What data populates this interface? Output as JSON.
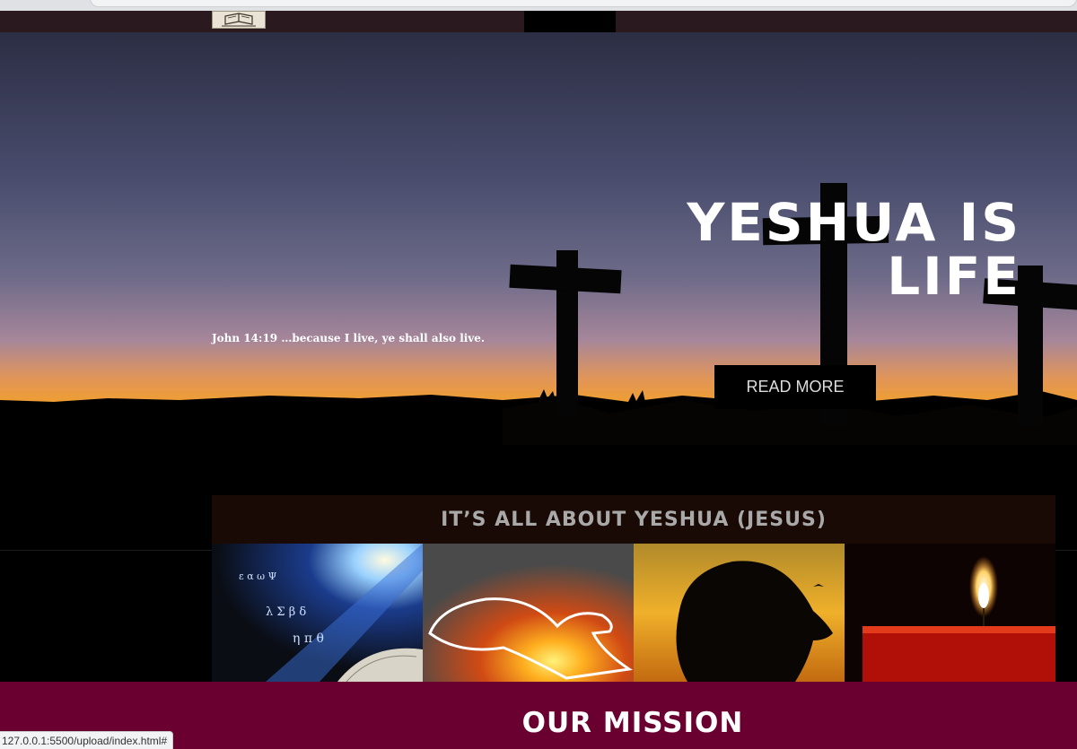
{
  "browser": {
    "status_url": "127.0.0.1:5500/upload/index.html#"
  },
  "navbar": {
    "logo_icon": "bible-book-icon"
  },
  "hero": {
    "title": "YESHUA IS LIFE",
    "verse": "John 14:19 …because I live, ye shall also live.",
    "button_label": "READ MORE"
  },
  "about": {
    "title": "IT’S ALL ABOUT YESHUA (JESUS)",
    "tiles": [
      "open-bible-light-image",
      "fiery-dove-image",
      "praying-silhouette-image",
      "candle-flame-image"
    ]
  },
  "mission": {
    "title": "OUR MISSION"
  },
  "colors": {
    "mission_bg": "#6a0030",
    "about_header_bg": "#1a0a05",
    "button_bg": "#000000"
  }
}
